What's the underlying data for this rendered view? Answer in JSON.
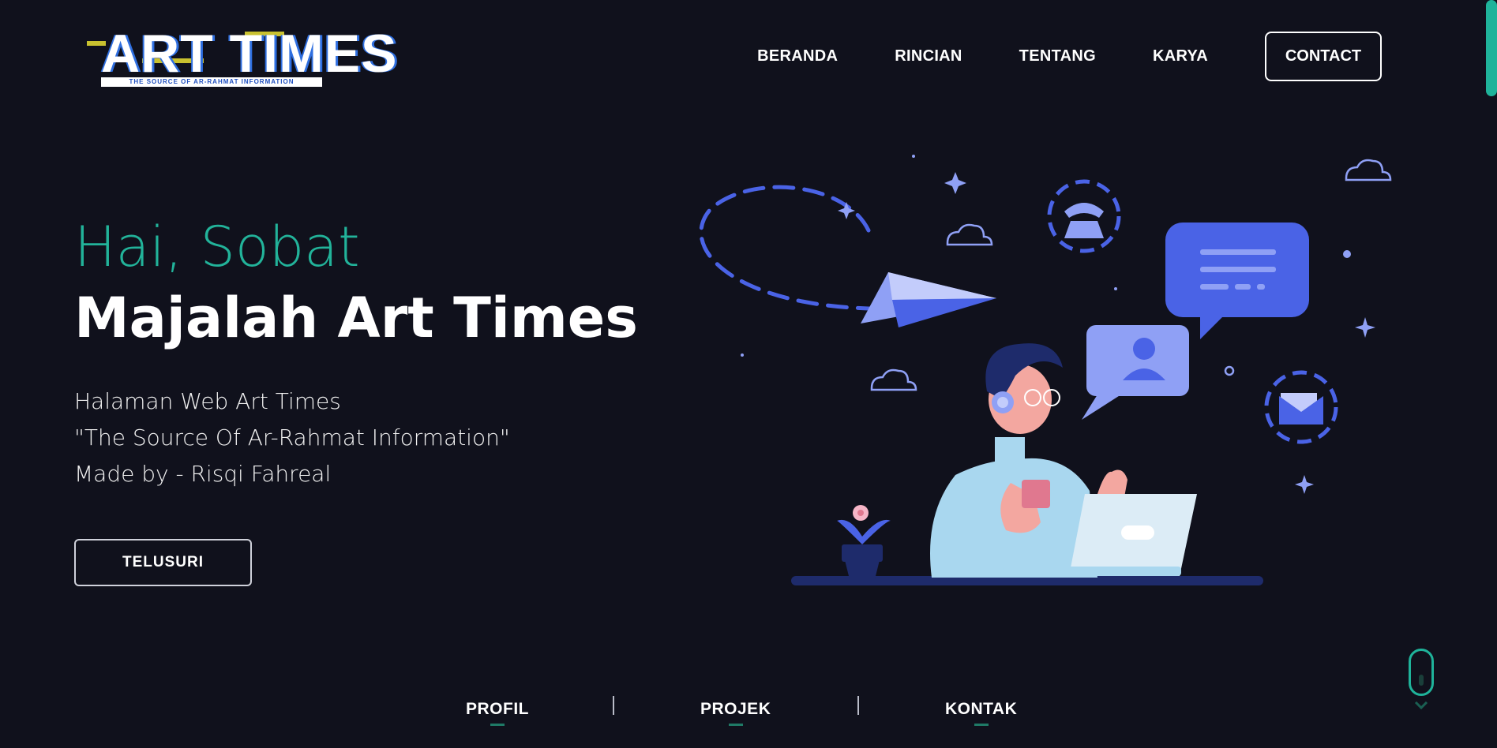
{
  "logo": {
    "text": "ART TIMES",
    "subtitle": "THE SOURCE OF AR-RAHMAT INFORMATION"
  },
  "nav": {
    "items": [
      "BERANDA",
      "RINCIAN",
      "TENTANG",
      "KARYA"
    ],
    "contact_label": "CONTACT"
  },
  "hero": {
    "greeting": "Hai, Sobat",
    "title": "Majalah Art Times",
    "lines": [
      "Halaman Web Art Times",
      "\"The Source Of Ar-Rahmat Information\"",
      "Made by - Risqi Fahreal"
    ],
    "cta_label": "TELUSURI"
  },
  "bottom_nav": {
    "items": [
      "PROFIL",
      "PROJEK",
      "KONTAK"
    ]
  },
  "colors": {
    "background": "#10111c",
    "accent": "#22b39a",
    "illustration_blue": "#4a63e6"
  }
}
